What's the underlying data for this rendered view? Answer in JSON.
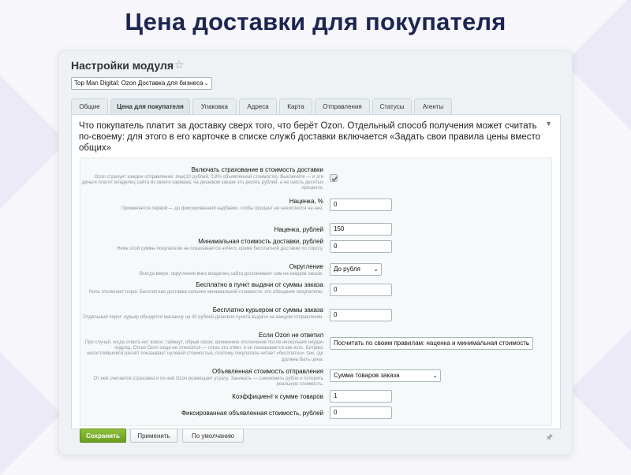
{
  "hero": {
    "title": "Цена доставки для покупателя"
  },
  "window": {
    "title": "Настройки модуля",
    "module_select": "Top Man Digital: Ozon Доставка для бизнеса"
  },
  "tabs": [
    {
      "label": "Общие"
    },
    {
      "label": "Цена для покупателя",
      "active": true
    },
    {
      "label": "Упаковка"
    },
    {
      "label": "Адреса"
    },
    {
      "label": "Карта"
    },
    {
      "label": "Отправления"
    },
    {
      "label": "Статусы"
    },
    {
      "label": "Агенты"
    }
  ],
  "panel": {
    "description": "Что покупатель платит за доставку сверх того, что берёт Ozon. Отдельный способ получения может считать по-своему: для этого в его карточке в списке служб доставки включается «Задать свои правила цены вместо общих»"
  },
  "form": {
    "insurance": {
      "label": "Включать страхование в стоимость доставки",
      "hint": "Ozon страхует каждое отправление: max(10 рублей, 0,8% объявленной стоимости). Выключите — и эти деньги платит владелец сайта из своего кармана; на дешевом заказе это десять рублей, а не шесть десятых процента.",
      "checked": true
    },
    "markup_percent": {
      "label": "Наценка, %",
      "hint": "Применяется первой — до фиксированной надбавки, чтобы процент не начислялся на нее.",
      "value": "0"
    },
    "markup_rub": {
      "label": "Наценка, рублей",
      "value": "150"
    },
    "min_cost": {
      "label": "Минимальная стоимость доставки, рублей",
      "hint": "Ниже этой суммы покупателю не показывается ничего, кроме бесплатной доставки по порогу.",
      "value": "0"
    },
    "rounding": {
      "label": "Округление",
      "hint": "Всегда вверх: округление вниз владелец сайта доплачивает сам на каждом заказе.",
      "value": "До рубля"
    },
    "free_pickup": {
      "label": "Бесплатно в пункт выдачи от суммы заказа",
      "hint": "Ноль отключает порог. Бесплатная доставка сильнее минимальной стоимости: это обещание покупателю.",
      "value": "0"
    },
    "free_courier": {
      "label": "Бесплатно курьером от суммы заказа",
      "hint": "Отдельный порог: курьер обходится магазину на 30 рублей дешевле пункта выдачи на каждом отправлении.",
      "value": "0"
    },
    "ozon_no_answer": {
      "label": "Если Ozon не ответил",
      "hint": "Про случай, когда ответа нет вовсе: таймаут, обрыв связи, временное отключение после нескольких неудач подряд. Отказ Ozon сюда не относится — отказ это ответ, и он показывается как есть. Битрикс несостоявшийся расчёт показывает нулевой стоимостью, поэтому покупатель читает «бесплатно» там, где должна быть цена.",
      "value": "Посчитать по своим правилам: наценка и минимальная стоимость"
    },
    "declared_value": {
      "label": "Объявленная стоимость отправления",
      "hint": "От неё считается страховка и по ней Ozon возмещает утрату. Занижать — сэкономить рубли и потерять реальную стоимость.",
      "value": "Сумма товаров заказа"
    },
    "coefficient": {
      "label": "Коэффициент к сумме товаров",
      "value": "1"
    },
    "fixed_declared": {
      "label": "Фиксированная объявленная стоимость, рублей",
      "value": "0"
    }
  },
  "footer": {
    "save": "Сохранить",
    "apply": "Применить",
    "default": "По умолчанию"
  },
  "colors": {
    "accent": "#1d2550",
    "primary_button": "#78a92a"
  }
}
